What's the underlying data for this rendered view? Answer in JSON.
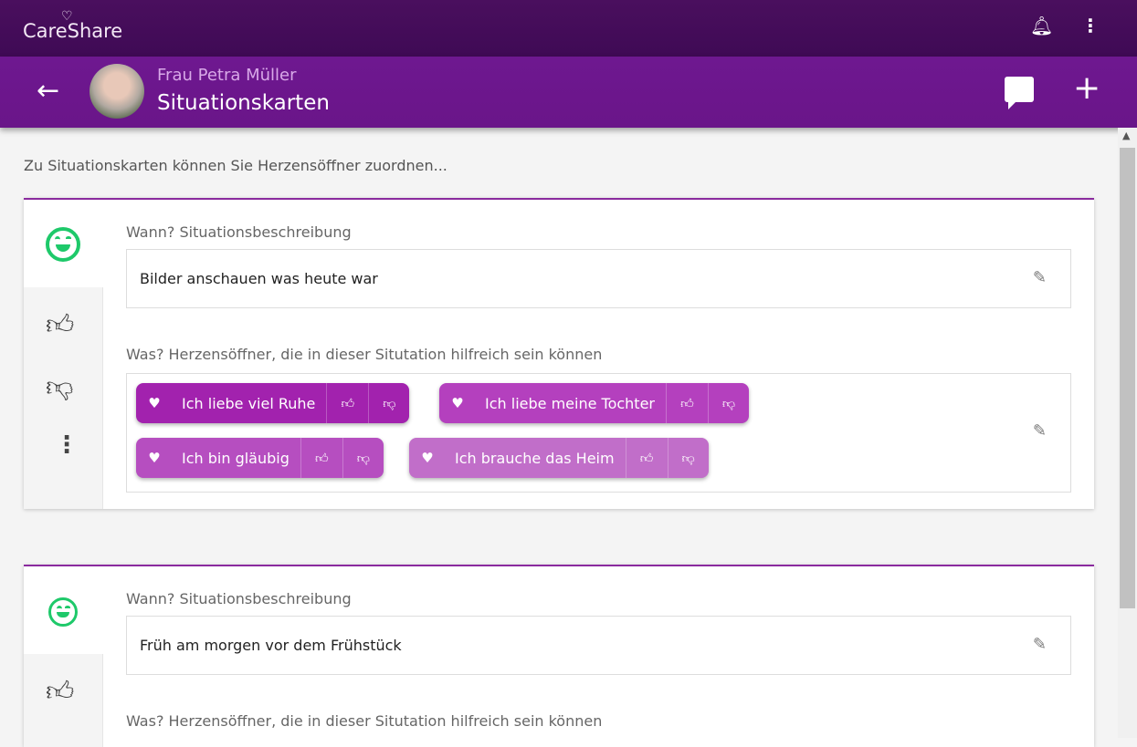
{
  "app": {
    "name": "CareShare",
    "notifications_icon": "bell-icon",
    "menu_icon": "more-vert-icon"
  },
  "header": {
    "person": "Frau Petra Müller",
    "title": "Situationskarten"
  },
  "intro": "Zu Situationskarten können Sie Herzensöffner zuordnen...",
  "colors": {
    "accent": "#6e1890",
    "smile": "#1ec96a"
  },
  "cards": [
    {
      "when_label": "Wann? Situationsbeschreibung",
      "situation": "Bilder anschauen was heute war",
      "what_label": "Was? Herzensöffner, die in dieser Situtation hilfreich sein können",
      "chips": [
        {
          "label": "Ich liebe viel Ruhe",
          "color": "#a222ae"
        },
        {
          "label": "Ich liebe meine Tochter",
          "color": "#b440be"
        },
        {
          "label": "Ich bin gläubig",
          "color": "#b64ec0"
        },
        {
          "label": "Ich brauche das Heim",
          "color": "#c16ec9"
        }
      ]
    },
    {
      "when_label": "Wann? Situationsbeschreibung",
      "situation": "Früh am morgen vor dem Frühstück",
      "what_label": "Was? Herzensöffner, die in dieser Situtation hilfreich sein können"
    }
  ]
}
